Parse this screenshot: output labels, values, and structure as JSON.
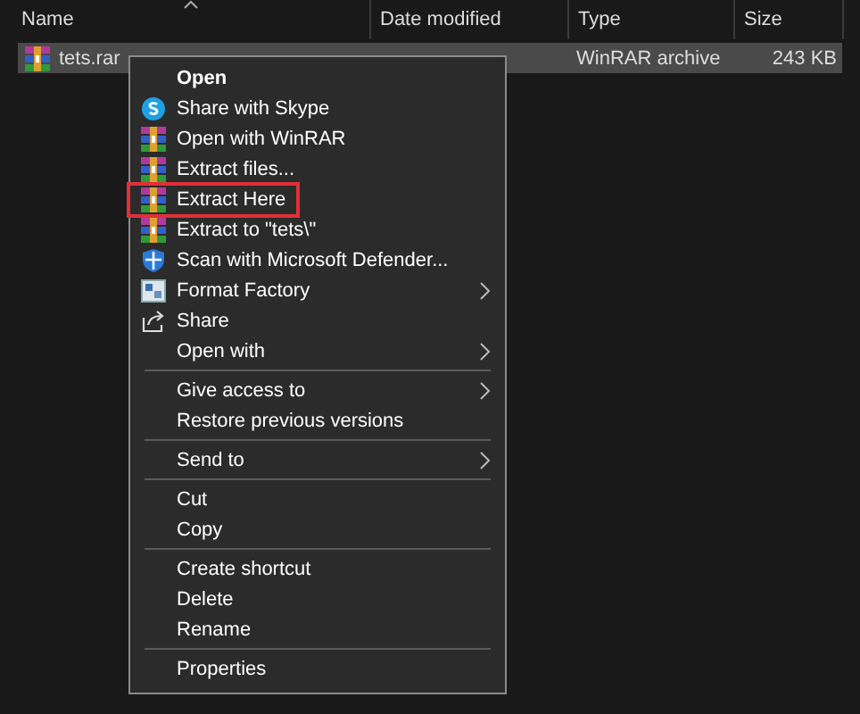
{
  "columns": [
    {
      "label": "Name",
      "sorted": true
    },
    {
      "label": "Date modified",
      "sorted": false
    },
    {
      "label": "Type",
      "sorted": false
    },
    {
      "label": "Size",
      "sorted": false
    }
  ],
  "files": [
    {
      "name": "tets.rar",
      "type": "WinRAR archive",
      "size": "243 KB",
      "selected": true
    }
  ],
  "context_menu": {
    "groups": [
      [
        {
          "label": "Open",
          "default": true,
          "submenu": false,
          "highlighted": false
        },
        {
          "label": "Share with Skype",
          "kind": "skype",
          "default": false,
          "submenu": false,
          "highlighted": false
        },
        {
          "label": "Open with WinRAR",
          "kind": "winrar",
          "default": false,
          "submenu": false,
          "highlighted": false
        },
        {
          "label": "Extract files...",
          "kind": "winrar",
          "default": false,
          "submenu": false,
          "highlighted": false
        },
        {
          "label": "Extract Here",
          "kind": "winrar",
          "default": false,
          "submenu": false,
          "highlighted": true
        },
        {
          "label": "Extract to \"tets\\\"",
          "kind": "winrar",
          "default": false,
          "submenu": false,
          "highlighted": false
        },
        {
          "label": "Scan with Microsoft Defender...",
          "kind": "defender",
          "default": false,
          "submenu": false,
          "highlighted": false
        },
        {
          "label": "Format Factory",
          "kind": "formatfactory",
          "default": false,
          "submenu": true,
          "highlighted": false
        },
        {
          "label": "Share",
          "kind": "share",
          "default": false,
          "submenu": false,
          "highlighted": false
        },
        {
          "label": "Open with",
          "default": false,
          "submenu": true,
          "highlighted": false
        }
      ],
      [
        {
          "label": "Give access to",
          "default": false,
          "submenu": true,
          "highlighted": false
        },
        {
          "label": "Restore previous versions",
          "default": false,
          "submenu": false,
          "highlighted": false
        }
      ],
      [
        {
          "label": "Send to",
          "default": false,
          "submenu": true,
          "highlighted": false
        }
      ],
      [
        {
          "label": "Cut",
          "default": false,
          "submenu": false,
          "highlighted": false
        },
        {
          "label": "Copy",
          "default": false,
          "submenu": false,
          "highlighted": false
        }
      ],
      [
        {
          "label": "Create shortcut",
          "default": false,
          "submenu": false,
          "highlighted": false
        },
        {
          "label": "Delete",
          "default": false,
          "submenu": false,
          "highlighted": false
        },
        {
          "label": "Rename",
          "default": false,
          "submenu": false,
          "highlighted": false
        }
      ],
      [
        {
          "label": "Properties",
          "default": false,
          "submenu": false,
          "highlighted": false
        }
      ]
    ]
  }
}
